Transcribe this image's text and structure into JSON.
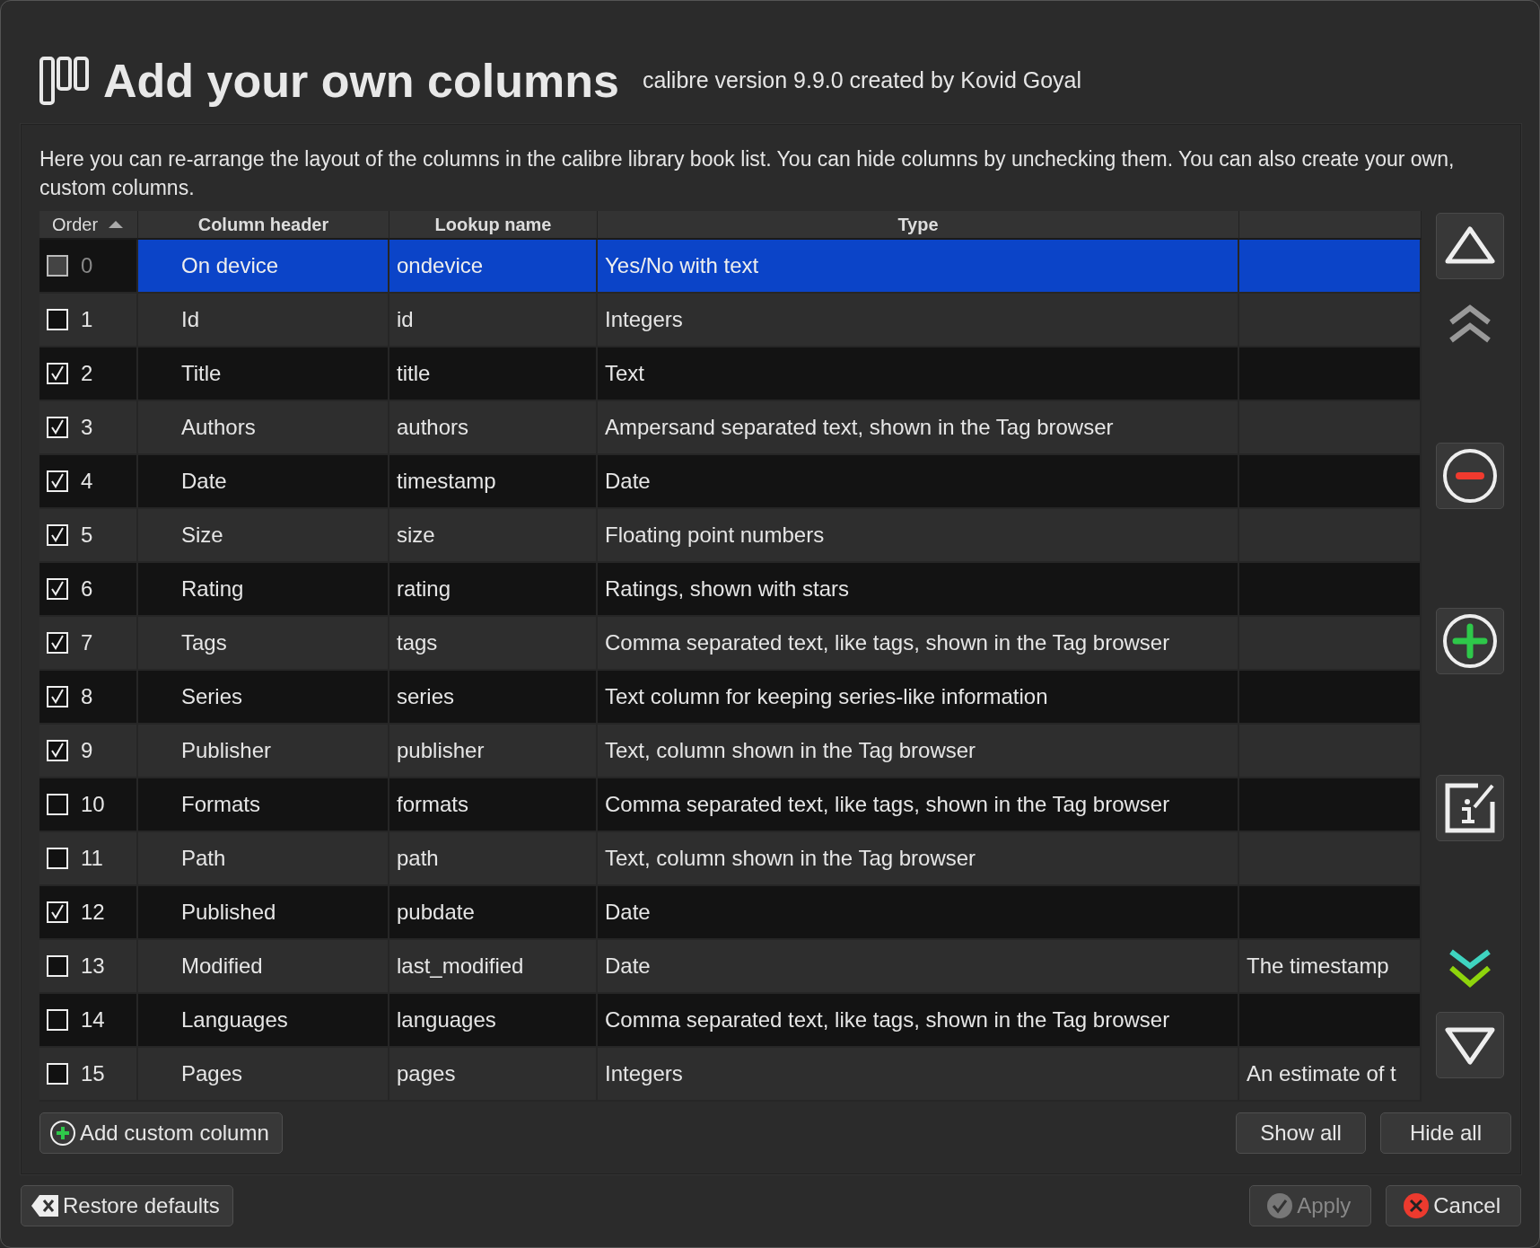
{
  "header": {
    "title": "Add your own columns",
    "subtitle": "calibre version 9.9.0 created by Kovid Goyal"
  },
  "description": "Here you can re-arrange the layout of the columns in the calibre library book list. You can hide columns by unchecking them. You can also create your own, custom columns.",
  "table": {
    "columns": [
      {
        "label": "Order",
        "sorted": true
      },
      {
        "label": "Column header",
        "sorted": false
      },
      {
        "label": "Lookup name",
        "sorted": false
      },
      {
        "label": "Type",
        "sorted": false
      }
    ],
    "rows": [
      {
        "order": "0",
        "header": "On device",
        "lookup": "ondevice",
        "type": "Yes/No with text",
        "checked": false,
        "disabled": true,
        "selected": true
      },
      {
        "order": "1",
        "header": "Id",
        "lookup": "id",
        "type": "Integers",
        "checked": false,
        "disabled": false,
        "selected": false
      },
      {
        "order": "2",
        "header": "Title",
        "lookup": "title",
        "type": "Text",
        "checked": true,
        "disabled": false,
        "selected": false
      },
      {
        "order": "3",
        "header": "Authors",
        "lookup": "authors",
        "type": "Ampersand separated text, shown in the Tag browser",
        "checked": true,
        "disabled": false,
        "selected": false
      },
      {
        "order": "4",
        "header": "Date",
        "lookup": "timestamp",
        "type": "Date",
        "checked": true,
        "disabled": false,
        "selected": false
      },
      {
        "order": "5",
        "header": "Size",
        "lookup": "size",
        "type": "Floating point numbers",
        "checked": true,
        "disabled": false,
        "selected": false
      },
      {
        "order": "6",
        "header": "Rating",
        "lookup": "rating",
        "type": "Ratings, shown with stars",
        "checked": true,
        "disabled": false,
        "selected": false
      },
      {
        "order": "7",
        "header": "Tags",
        "lookup": "tags",
        "type": "Comma separated text, like tags, shown in the Tag browser",
        "checked": true,
        "disabled": false,
        "selected": false
      },
      {
        "order": "8",
        "header": "Series",
        "lookup": "series",
        "type": "Text column for keeping series-like information",
        "checked": true,
        "disabled": false,
        "selected": false
      },
      {
        "order": "9",
        "header": "Publisher",
        "lookup": "publisher",
        "type": "Text, column shown in the Tag browser",
        "checked": true,
        "disabled": false,
        "selected": false
      },
      {
        "order": "10",
        "header": "Formats",
        "lookup": "formats",
        "type": "Comma separated text, like tags, shown in the Tag browser",
        "checked": false,
        "disabled": false,
        "selected": false
      },
      {
        "order": "11",
        "header": "Path",
        "lookup": "path",
        "type": "Text, column shown in the Tag browser",
        "checked": false,
        "disabled": false,
        "selected": false
      },
      {
        "order": "12",
        "header": "Published",
        "lookup": "pubdate",
        "type": "Date",
        "checked": true,
        "disabled": false,
        "selected": false
      },
      {
        "order": "13",
        "header": "Modified",
        "lookup": "last_modified",
        "type": "Date",
        "note": "The timestamp",
        "checked": false,
        "disabled": false,
        "selected": false
      },
      {
        "order": "14",
        "header": "Languages",
        "lookup": "languages",
        "type": "Comma separated text, like tags, shown in the Tag browser",
        "checked": false,
        "disabled": false,
        "selected": false
      },
      {
        "order": "15",
        "header": "Pages",
        "lookup": "pages",
        "type": "Integers",
        "note": "An estimate of t",
        "checked": false,
        "disabled": false,
        "selected": false
      }
    ]
  },
  "table_buttons": {
    "add": "Add custom column",
    "show_all": "Show all",
    "hide_all": "Hide all"
  },
  "footer": {
    "restore": "Restore defaults",
    "buttons": [
      {
        "label": "Apply",
        "kind": "apply",
        "disabled": true
      },
      {
        "label": "Cancel",
        "kind": "cancel",
        "disabled": false
      }
    ]
  }
}
